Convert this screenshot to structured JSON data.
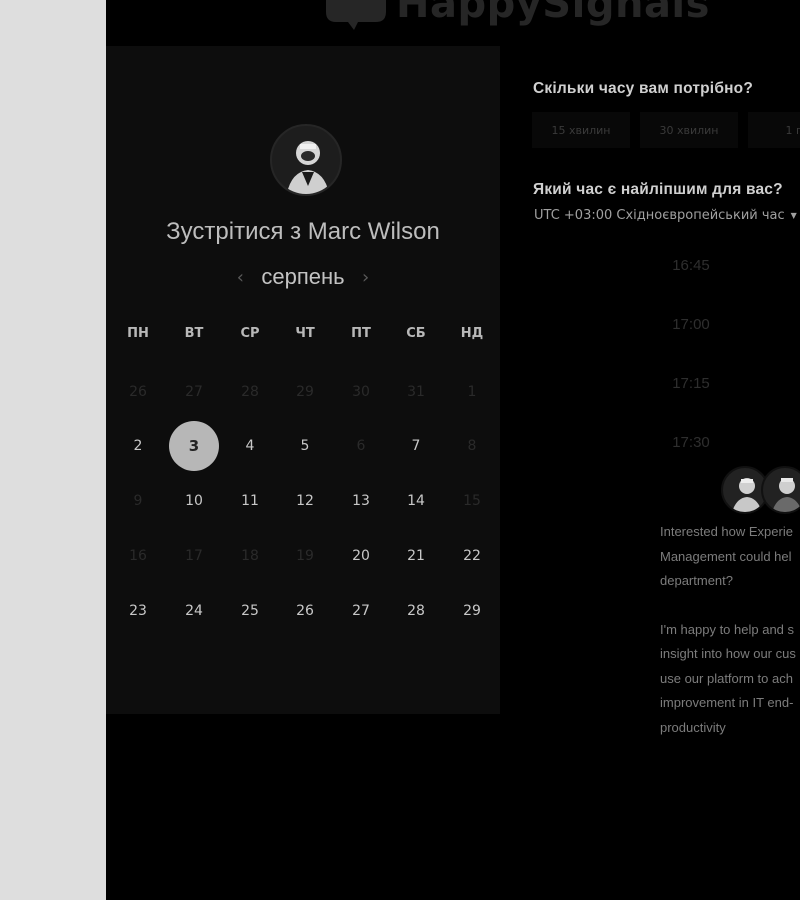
{
  "brand": {
    "name": "HappySignals"
  },
  "card": {
    "title": "Зустрітися з Marc Wilson",
    "month": "серпень",
    "weekdays": [
      "ПН",
      "ВТ",
      "СР",
      "ЧТ",
      "ПТ",
      "СБ",
      "НД"
    ],
    "weeks": [
      [
        {
          "d": "26",
          "muted": true
        },
        {
          "d": "27",
          "muted": true
        },
        {
          "d": "28",
          "muted": true
        },
        {
          "d": "29",
          "muted": true
        },
        {
          "d": "30",
          "muted": true
        },
        {
          "d": "31",
          "muted": true
        },
        {
          "d": "1",
          "muted": true
        }
      ],
      [
        {
          "d": "2"
        },
        {
          "d": "3",
          "selected": true
        },
        {
          "d": "4"
        },
        {
          "d": "5"
        },
        {
          "d": "6",
          "muted": true
        },
        {
          "d": "7"
        },
        {
          "d": "8",
          "muted": true
        }
      ],
      [
        {
          "d": "9",
          "muted": true
        },
        {
          "d": "10"
        },
        {
          "d": "11"
        },
        {
          "d": "12"
        },
        {
          "d": "13"
        },
        {
          "d": "14"
        },
        {
          "d": "15",
          "muted": true
        }
      ],
      [
        {
          "d": "16",
          "muted": true
        },
        {
          "d": "17",
          "muted": true
        },
        {
          "d": "18",
          "muted": true
        },
        {
          "d": "19",
          "muted": true
        },
        {
          "d": "20"
        },
        {
          "d": "21"
        },
        {
          "d": "22"
        }
      ],
      [
        {
          "d": "23"
        },
        {
          "d": "24"
        },
        {
          "d": "25"
        },
        {
          "d": "26"
        },
        {
          "d": "27"
        },
        {
          "d": "28"
        },
        {
          "d": "29"
        }
      ]
    ]
  },
  "duration": {
    "title": "Скільки часу вам потрібно?",
    "options": [
      "15 хвилин",
      "30 хвилин",
      "1 го"
    ]
  },
  "time": {
    "title": "Який час є найліпшим для вас?",
    "timezone": "UTC +03:00 Східноєвропейський час",
    "slots": [
      "16:45",
      "17:00",
      "17:15",
      "17:30"
    ]
  },
  "intro": {
    "paragraph1": [
      "Interested how Experie",
      "Management could hel",
      "department?"
    ],
    "paragraph2": [
      "I'm happy to help and s",
      "insight into how our cus",
      "use our platform to ach",
      "improvement in IT end-",
      "productivity"
    ]
  },
  "icons": {
    "prev": "chevron-left-icon",
    "next": "chevron-right-icon",
    "caret": "caret-down-icon"
  }
}
